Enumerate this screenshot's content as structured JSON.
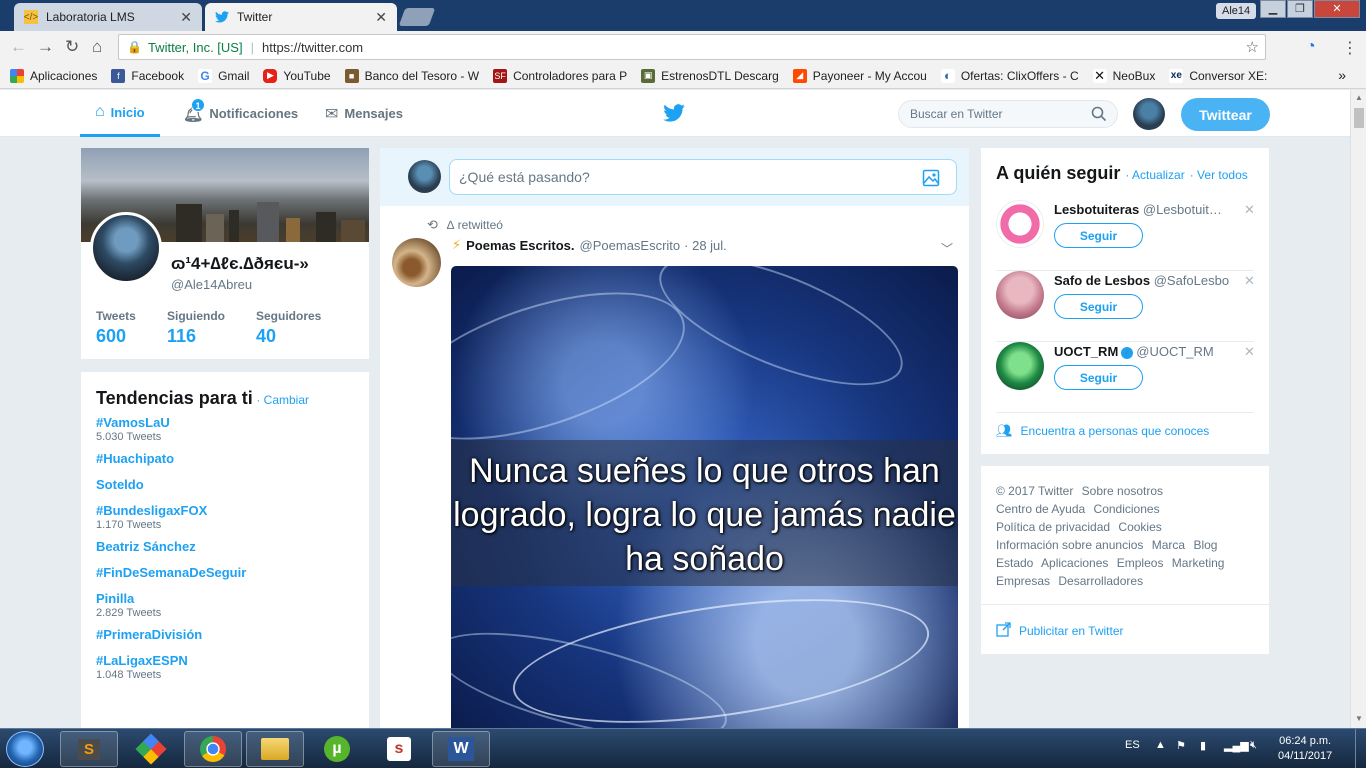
{
  "browser": {
    "tabs": [
      {
        "label": "Laboratoria LMS",
        "active": false
      },
      {
        "label": "Twitter",
        "active": true
      }
    ],
    "profile_name": "Ale14",
    "address": {
      "secure_label": "Twitter, Inc. [US]",
      "url": "https://twitter.com"
    },
    "bookmarks": [
      {
        "label": "Aplicaciones",
        "icon": "apps-grid-icon"
      },
      {
        "label": "Facebook",
        "icon": "facebook-icon"
      },
      {
        "label": "Gmail",
        "icon": "google-icon"
      },
      {
        "label": "YouTube",
        "icon": "youtube-icon"
      },
      {
        "label": "Banco del Tesoro - W",
        "icon": "bank-icon"
      },
      {
        "label": "Controladores para P",
        "icon": "drivers-icon"
      },
      {
        "label": "EstrenosDTL Descarg",
        "icon": "movie-icon"
      },
      {
        "label": "Payoneer - My Accou",
        "icon": "payoneer-icon"
      },
      {
        "label": "Ofertas: ClixOffers - C",
        "icon": "clixoffers-icon"
      },
      {
        "label": "NeoBux",
        "icon": "neobux-icon"
      },
      {
        "label": "Conversor XE:",
        "icon": "xe-icon"
      }
    ],
    "more_bookmarks": "»"
  },
  "twitter_nav": {
    "home": "Inicio",
    "notifications": "Notificaciones",
    "notifications_count": "1",
    "messages": "Mensajes",
    "search_placeholder": "Buscar en Twitter",
    "tweet_button": "Twittear"
  },
  "profile": {
    "name": "ɷ¹4+∆ℓє.∆ðяєu-»",
    "handle": "@Ale14Abreu",
    "stats": [
      {
        "label": "Tweets",
        "value": "600"
      },
      {
        "label": "Siguiendo",
        "value": "116"
      },
      {
        "label": "Seguidores",
        "value": "40"
      }
    ]
  },
  "trends": {
    "title": "Tendencias para ti",
    "change_link": "· Cambiar",
    "items": [
      {
        "name": "#VamosLaU",
        "count": "5.030 Tweets"
      },
      {
        "name": "#Huachipato",
        "count": ""
      },
      {
        "name": "Soteldo",
        "count": ""
      },
      {
        "name": "#BundesligaxFOX",
        "count": "1.170 Tweets"
      },
      {
        "name": "Beatriz Sánchez",
        "count": ""
      },
      {
        "name": "#FinDeSemanaDeSeguir",
        "count": ""
      },
      {
        "name": "Pinilla",
        "count": "2.829 Tweets"
      },
      {
        "name": "#PrimeraDivisión",
        "count": ""
      },
      {
        "name": "#LaLigaxESPN",
        "count": "1.048 Tweets"
      }
    ]
  },
  "timeline": {
    "compose_placeholder": "¿Qué está pasando?",
    "tweet": {
      "retweet_line": "∆ retwitteó",
      "author_name": "Poemas Escritos.",
      "author_handle": "@PoemasEscrito",
      "time": "· 28 jul.",
      "image_quote": "Nunca sueñes lo que otros han logrado, logra lo que jamás nadie ha soñado"
    }
  },
  "who_to_follow": {
    "title": "A quién seguir",
    "refresh": "· Actualizar",
    "view_all": "· Ver todos",
    "follow_label": "Seguir",
    "items": [
      {
        "name": "Lesbotuiteras",
        "handle": "@Lesbotuit…",
        "verified": false
      },
      {
        "name": "Safo de Lesbos",
        "handle": "@SafoLesbo",
        "verified": false
      },
      {
        "name": "UOCT_RM",
        "handle": "@UOCT_RM",
        "verified": true
      }
    ],
    "find_people": "Encuentra a personas que conoces"
  },
  "footer": {
    "links": [
      "© 2017 Twitter",
      "Sobre nosotros",
      "Centro de Ayuda",
      "Condiciones",
      "Política de privacidad",
      "Cookies",
      "Información sobre anuncios",
      "Marca",
      "Blog",
      "Estado",
      "Aplicaciones",
      "Empleos",
      "Marketing",
      "Empresas",
      "Desarrolladores"
    ],
    "advertise": "Publicitar en Twitter"
  },
  "taskbar": {
    "language": "ES",
    "time": "06:24 p.m.",
    "date": "04/11/2017"
  },
  "colors": {
    "twitter_blue": "#1da1f2",
    "tweet_button": "#4ab3f4",
    "background": "#e6ecf0"
  }
}
